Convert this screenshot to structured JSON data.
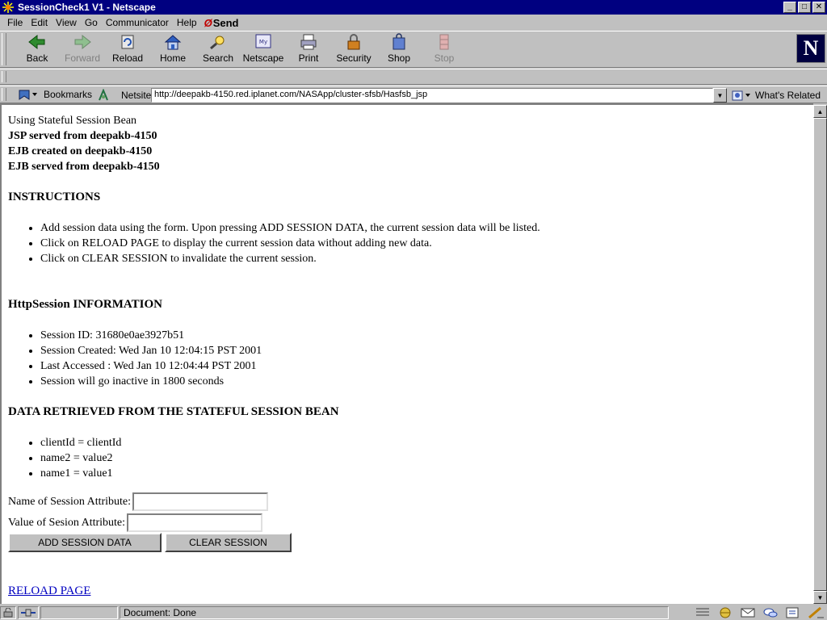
{
  "window": {
    "title": "SessionCheck1 V1 - Netscape",
    "min_btn": "_",
    "max_btn": "□",
    "close_btn": "✕"
  },
  "menu": {
    "items": [
      "File",
      "Edit",
      "View",
      "Go",
      "Communicator",
      "Help"
    ],
    "send": "Send"
  },
  "toolbar": {
    "back": "Back",
    "forward": "Forward",
    "reload": "Reload",
    "home": "Home",
    "search": "Search",
    "netscape": "Netscape",
    "print": "Print",
    "security": "Security",
    "shop": "Shop",
    "stop": "Stop",
    "logo": "N"
  },
  "location": {
    "bookmarks": "Bookmarks",
    "label": "Netsite:",
    "url": "http://deepakb-4150.red.iplanet.com/NASApp/cluster-sfsb/Hasfsb_jsp",
    "whats_related": "What's Related"
  },
  "page": {
    "line1": "Using Stateful Session Bean",
    "line2": "JSP served from deepakb-4150",
    "line3": "EJB created on deepakb-4150",
    "line4": "EJB served from deepakb-4150",
    "instructions_heading": "INSTRUCTIONS",
    "instructions": [
      "Add session data using the form. Upon pressing ADD SESSION DATA, the current session data will be listed.",
      "Click on RELOAD PAGE to display the current session data without adding new data.",
      "Click on CLEAR SESSION to invalidate the current session."
    ],
    "session_heading": "HttpSession INFORMATION",
    "session_info": [
      "Session ID: 31680e0ae3927b51",
      "Session Created: Wed Jan 10 12:04:15 PST 2001",
      "Last Accessed : Wed Jan 10 12:04:44 PST 2001",
      "Session will go inactive in 1800 seconds"
    ],
    "data_heading": "DATA RETRIEVED FROM THE STATEFUL SESSION BEAN",
    "data_items": [
      "clientId = clientId",
      "name2 = value2",
      "name1 = value1"
    ],
    "name_label": "Name of Session Attribute:",
    "value_label": "Value of Sesion Attribute:",
    "add_button": "ADD SESSION DATA",
    "clear_button": "CLEAR SESSION",
    "reload_link": "RELOAD PAGE"
  },
  "status": {
    "text": "Document: Done"
  },
  "colors": {
    "titlebar": "#000080",
    "link": "#0000c0",
    "chrome": "#c0c0c0"
  }
}
